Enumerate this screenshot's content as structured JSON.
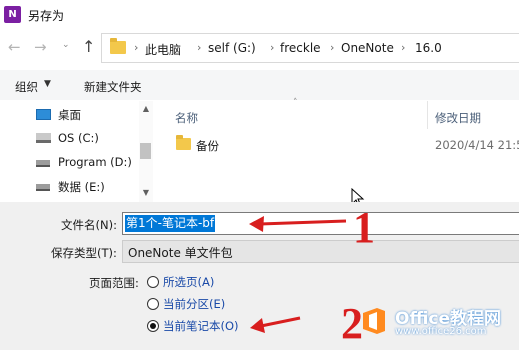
{
  "window": {
    "title": "另存为",
    "app_icon_letter": "N"
  },
  "nav": {
    "back_icon": "arrow-left-icon",
    "forward_icon": "arrow-right-icon",
    "up_icon": "arrow-up-icon"
  },
  "breadcrumb": [
    "此电脑",
    "self (G:)",
    "freckle",
    "OneNote",
    "16.0"
  ],
  "toolbar": {
    "organize": "组织",
    "new_folder": "新建文件夹"
  },
  "sidebar": {
    "items": [
      {
        "label": "桌面",
        "icon": "desktop-icon"
      },
      {
        "label": "OS (C:)",
        "icon": "windows-drive-icon"
      },
      {
        "label": "Program (D:)",
        "icon": "drive-icon"
      },
      {
        "label": "数据 (E:)",
        "icon": "drive-icon"
      }
    ]
  },
  "filelist": {
    "columns": [
      "名称",
      "修改日期"
    ],
    "rows": [
      {
        "name": "备份",
        "modified": "2020/4/14 21:5"
      }
    ]
  },
  "form": {
    "filename_label": "文件名(N):",
    "filename_value": "第1个-笔记本-bf",
    "savetype_label": "保存类型(T):",
    "savetype_value": "OneNote 单文件包",
    "range_label": "页面范围:",
    "range_options": [
      {
        "label": "所选页(A)",
        "checked": false
      },
      {
        "label": "当前分区(E)",
        "checked": false
      },
      {
        "label": "当前笔记本(O)",
        "checked": true
      }
    ]
  },
  "annotations": {
    "num1": "1",
    "num2": "2"
  },
  "watermark": {
    "title": "Office教程网",
    "url": "www.office26.com"
  },
  "colors": {
    "annotation": "#d81e1e",
    "selection": "#0078d7",
    "watermark": "#2a7fd4"
  }
}
